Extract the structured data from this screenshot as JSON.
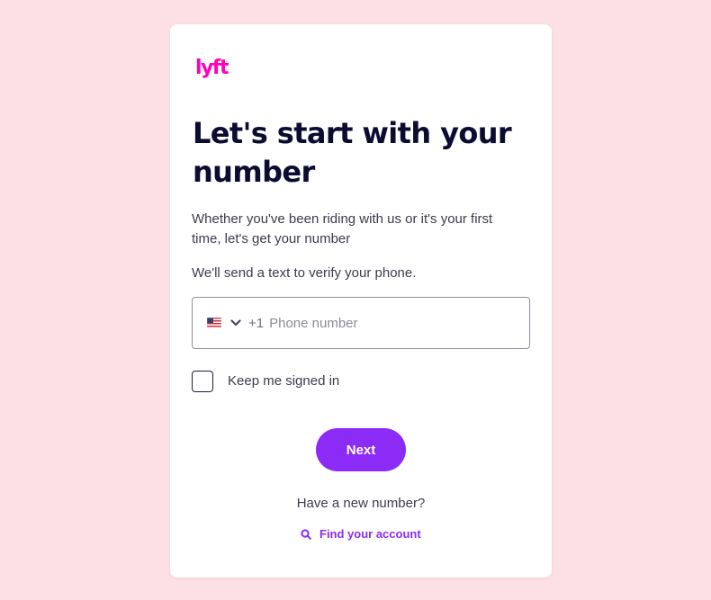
{
  "brand": {
    "logo_text": "lyft",
    "logo_color": "#ff00bf"
  },
  "page": {
    "heading": "Let's start with your number",
    "subtitle": "Whether you've been riding with us or it's your first time, let's get your number",
    "verify_text": "We'll send a text to verify your phone."
  },
  "phone": {
    "country_flag_icon": "us-flag-icon",
    "country_code": "+1",
    "placeholder": "Phone number",
    "value": ""
  },
  "keep_signed_in": {
    "label": "Keep me signed in",
    "checked": false
  },
  "actions": {
    "next_label": "Next",
    "new_number_text": "Have a new number?",
    "find_account_label": "Find your account",
    "find_account_icon": "search-icon"
  },
  "colors": {
    "background": "#fde0e6",
    "accent": "#8b2bf5",
    "text": "#0c0b31"
  }
}
